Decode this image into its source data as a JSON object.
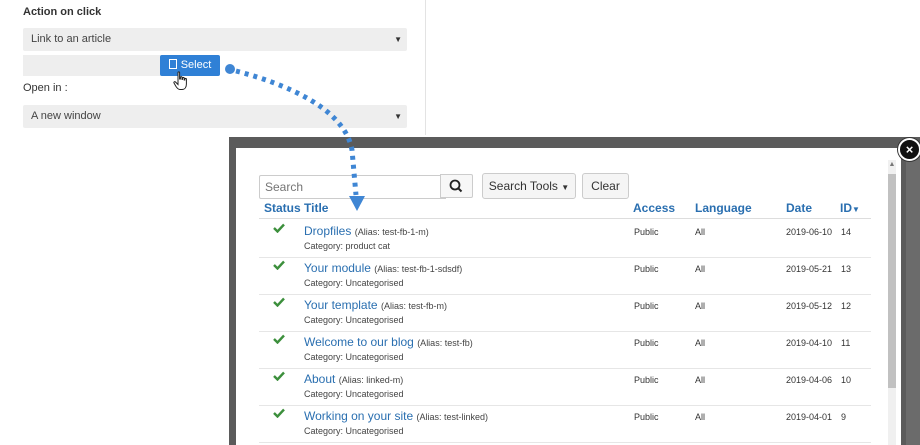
{
  "panel": {
    "heading": "Action on click",
    "action_select": "Link to an article",
    "select_button": "Select",
    "open_in_label": "Open in :",
    "open_in_select": "A new window"
  },
  "modal": {
    "search_placeholder": "Search",
    "search_tools_label": "Search Tools",
    "clear_label": "Clear",
    "columns": {
      "status": "Status",
      "title": "Title",
      "access": "Access",
      "language": "Language",
      "date": "Date",
      "id": "ID"
    },
    "rows": [
      {
        "title": "Dropfiles",
        "alias": "(Alias: test-fb-1-m)",
        "category": "Category: product cat",
        "access": "Public",
        "language": "All",
        "date": "2019-06-10",
        "id": "14"
      },
      {
        "title": "Your module",
        "alias": "(Alias: test-fb-1-sdsdf)",
        "category": "Category: Uncategorised",
        "access": "Public",
        "language": "All",
        "date": "2019-05-21",
        "id": "13"
      },
      {
        "title": "Your template",
        "alias": "(Alias: test-fb-m)",
        "category": "Category: Uncategorised",
        "access": "Public",
        "language": "All",
        "date": "2019-05-12",
        "id": "12"
      },
      {
        "title": "Welcome to our blog",
        "alias": "(Alias: test-fb)",
        "category": "Category: Uncategorised",
        "access": "Public",
        "language": "All",
        "date": "2019-04-10",
        "id": "11"
      },
      {
        "title": "About",
        "alias": "(Alias: linked-m)",
        "category": "Category: Uncategorised",
        "access": "Public",
        "language": "All",
        "date": "2019-04-06",
        "id": "10"
      },
      {
        "title": "Working on your site",
        "alias": "(Alias: test-linked)",
        "category": "Category: Uncategorised",
        "access": "Public",
        "language": "All",
        "date": "2019-04-01",
        "id": "9"
      }
    ]
  },
  "colors": {
    "accent": "#2f80d6",
    "link": "#2a6fb0",
    "check": "#3c8f3c",
    "arrow": "#3f86d4"
  }
}
